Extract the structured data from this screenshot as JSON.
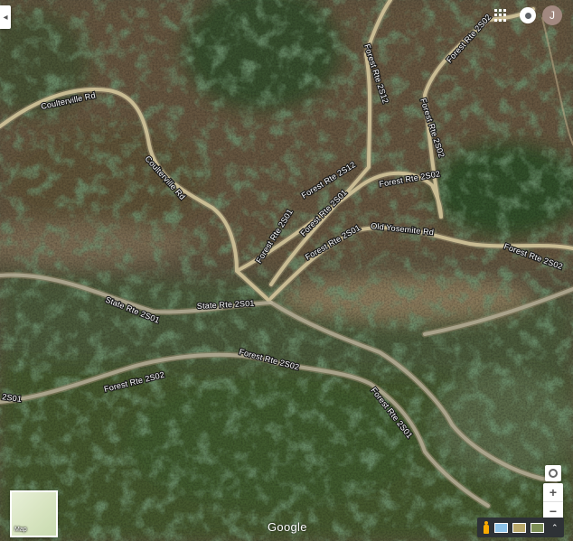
{
  "map": {
    "type": "satellite",
    "road_labels": {
      "coulterville_rd_a": "Coulterville Rd",
      "coulterville_rd_b": "Coulterville Rd",
      "fr_2s12_a": "Forest Rte 2S12",
      "fr_2s12_b": "Forest Rte 2S12",
      "fr_2s01_a": "Forest Rte 2S01",
      "fr_2s01_b": "Forest Rte 2S01",
      "fr_2s01_c": "Forest Rte 2S01",
      "fr_2s01_d": "Forest Rte 2S01",
      "fr_2s02_a": "Forest Rte 2S02",
      "fr_2s02_b": "Forest Rte 2S02",
      "fr_2s02_c": "Forest Rte 2S02",
      "fr_2s02_d": "Forest Rte 2S02",
      "fr_2s02_e": "Forest Rte 2S02",
      "fr_2s02_f": "Forest Rte 2S02",
      "state_rte_a": "State Rte 2S01",
      "state_rte_b": "State Rte 2S01",
      "old_yosemite_rd": "Old Yosemite Rd",
      "edge_label": "2S01"
    }
  },
  "controls": {
    "collapse_tab": "◂",
    "account_initial": "J",
    "map_toggle_label": "Map",
    "google_logo": "Google",
    "zoom_in": "+",
    "zoom_out": "−",
    "expand": "⌃"
  },
  "icons": {
    "collapse": "chevron-left-icon",
    "apps": "apps-grid-icon",
    "notifications": "notifications-icon",
    "locate": "my-location-icon",
    "pegman": "pegman-icon",
    "expand": "chevron-up-icon"
  },
  "colors": {
    "road": "#d2c49a",
    "road_shadow": "#8f8468",
    "avatar": "#a1887f",
    "pegman": "#f9ab00"
  }
}
